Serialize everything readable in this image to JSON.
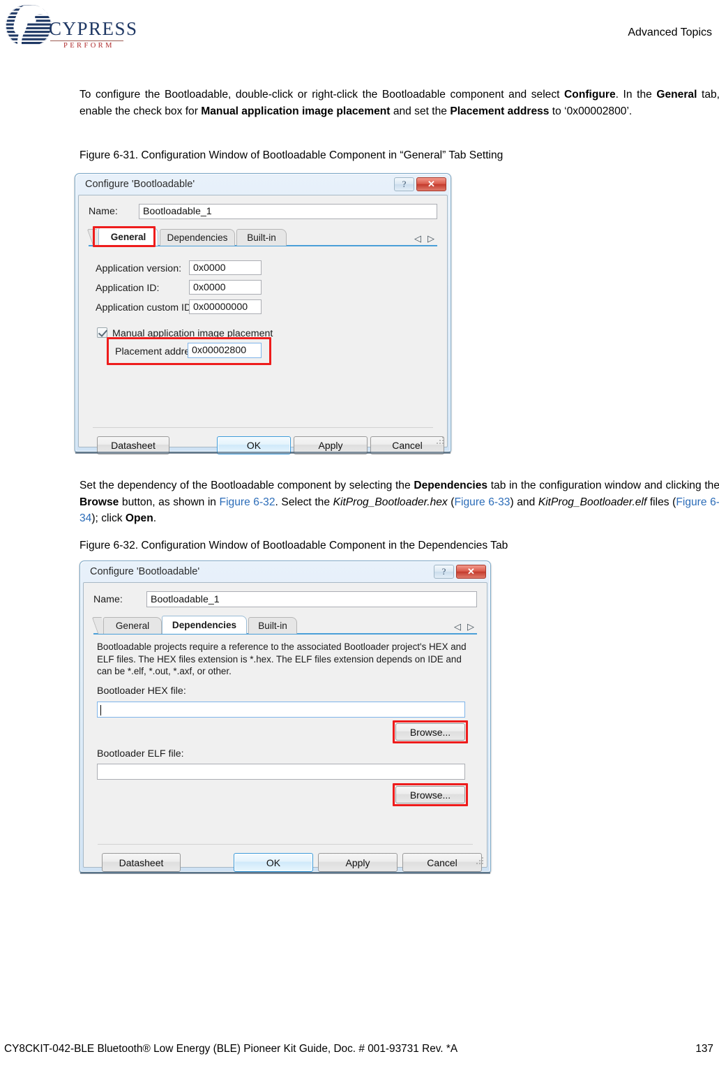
{
  "header": {
    "logo_text": "CYPRESS",
    "logo_tagline": "PERFORM",
    "section_title": "Advanced Topics"
  },
  "body": {
    "paragraph1_plain": "To configure the Bootloadable, double-click or right-click the Bootloadable component and select Configure. In the General tab, enable the check box for Manual application image placement and set the Placement address to ‘0x00002800’.",
    "figure31_caption": "Figure 6-31.  Configuration Window of Bootloadable Component in “General” Tab Setting",
    "paragraph2_plain": "Set the dependency of the Bootloadable component by selecting the Dependencies tab in the configuration window and clicking the Browse button, as shown in Figure 6-32. Select the KitProg_Bootloader.hex (Figure 6-33) and KitProg_Bootloader.elf files (Figure 6-34); click Open.",
    "figure32_caption": "Figure 6-32.  Configuration Window of Bootloadable Component in the Dependencies Tab",
    "p1": {
      "t1": "To configure the Bootloadable, double-click or right-click the Bootloadable component and select ",
      "b1": "Configure",
      "t2": ". In the ",
      "b2": "General",
      "t3": " tab, enable the check box for ",
      "b3": "Manual application image placement",
      "t4": " and set the ",
      "b4": "Placement address",
      "t5": " to ‘0x00002800’."
    },
    "p2": {
      "t1": "Set the dependency of the Bootloadable component by selecting the ",
      "b1": "Dependencies",
      "t2": " tab in the configuration window and clicking the ",
      "b2": "Browse",
      "t3": " button, as shown in ",
      "x1": "Figure 6-32",
      "t4": ". Select the ",
      "i1": "KitProg_Bootloader.hex",
      "t5": " (",
      "x2": "Figure 6-33",
      "t6": ") and ",
      "i2": "KitProg_Bootloader.elf",
      "t7": " files (",
      "x3": "Figure 6-34",
      "t8": "); click ",
      "b3": "Open",
      "t9": "."
    }
  },
  "dialog_general": {
    "title": "Configure 'Bootloadable'",
    "help_icon": "?",
    "close_icon": "✕",
    "name_label": "Name:",
    "name_value": "Bootloadable_1",
    "tabs": [
      {
        "label": "General",
        "active": true
      },
      {
        "label": "Dependencies",
        "active": false
      },
      {
        "label": "Built-in",
        "active": false
      }
    ],
    "nav_prev_icon": "◁",
    "nav_next_icon": "▷",
    "fields": [
      {
        "label": "Application version:",
        "value": "0x0000"
      },
      {
        "label": "Application ID:",
        "value": "0x0000"
      },
      {
        "label": "Application custom ID:",
        "value": "0x00000000"
      }
    ],
    "checkbox_label": "Manual application image placement",
    "checkbox_checked": true,
    "placement_label": "Placement address:",
    "placement_value": "0x00002800",
    "buttons": {
      "datasheet": "Datasheet",
      "ok": "OK",
      "apply": "Apply",
      "cancel": "Cancel"
    }
  },
  "dialog_dependencies": {
    "title": "Configure 'Bootloadable'",
    "help_icon": "?",
    "close_icon": "✕",
    "name_label": "Name:",
    "name_value": "Bootloadable_1",
    "tabs": [
      {
        "label": "General",
        "active": false
      },
      {
        "label": "Dependencies",
        "active": true
      },
      {
        "label": "Built-in",
        "active": false
      }
    ],
    "nav_prev_icon": "◁",
    "nav_next_icon": "▷",
    "description": "Bootloadable projects require a reference to the associated Bootloader project's HEX and ELF files. The HEX files extension is *.hex. The ELF files extension depends on IDE and can be *.elf, *.out, *.axf, or other.",
    "hex_label": "Bootloader HEX file:",
    "hex_value": "",
    "hex_browse": "Browse...",
    "elf_label": "Bootloader ELF file:",
    "elf_value": "",
    "elf_browse": "Browse...",
    "buttons": {
      "datasheet": "Datasheet",
      "ok": "OK",
      "apply": "Apply",
      "cancel": "Cancel"
    }
  },
  "footer": {
    "left": "CY8CKIT-042-BLE Bluetooth® Low Energy (BLE) Pioneer Kit Guide, Doc. # 001-93731 Rev. *A",
    "page_number": "137"
  },
  "colors": {
    "accent_blue": "#2b6cb8",
    "highlight_red": "#ee1c1c",
    "brand_navy": "#1f3864",
    "brand_red": "#b02b2c"
  }
}
